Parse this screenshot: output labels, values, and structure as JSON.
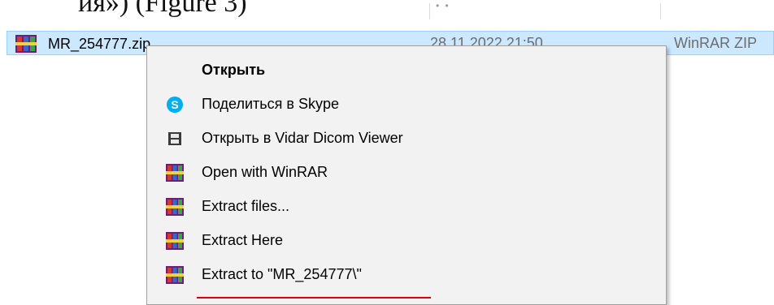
{
  "document": {
    "top_text": "ия») (Figure 3)"
  },
  "file_list": {
    "header_dots": "• •",
    "selected_file": {
      "name": "MR_254777.zip",
      "date": "28.11.2022 21:50",
      "type": "WinRAR ZIP",
      "icon": "winrar-icon"
    }
  },
  "context_menu": {
    "items": [
      {
        "label": "Открыть",
        "icon": "",
        "default": true
      },
      {
        "label": "Поделиться в Skype",
        "icon": "skype-icon"
      },
      {
        "label": "Открыть в Vidar Dicom Viewer",
        "icon": "film-icon"
      },
      {
        "label": "Open with WinRAR",
        "icon": "winrar-icon"
      },
      {
        "label": "Extract files...",
        "icon": "winrar-icon"
      },
      {
        "label": "Extract Here",
        "icon": "winrar-icon"
      },
      {
        "label": "Extract to \"MR_254777\\\"",
        "icon": "winrar-icon"
      }
    ]
  },
  "colors": {
    "selection_bg": "#cce8ff",
    "selection_border": "#99d1ff",
    "menu_bg": "#f2f2f2",
    "skype_blue": "#00aff0",
    "annotation_red": "#e00000"
  }
}
